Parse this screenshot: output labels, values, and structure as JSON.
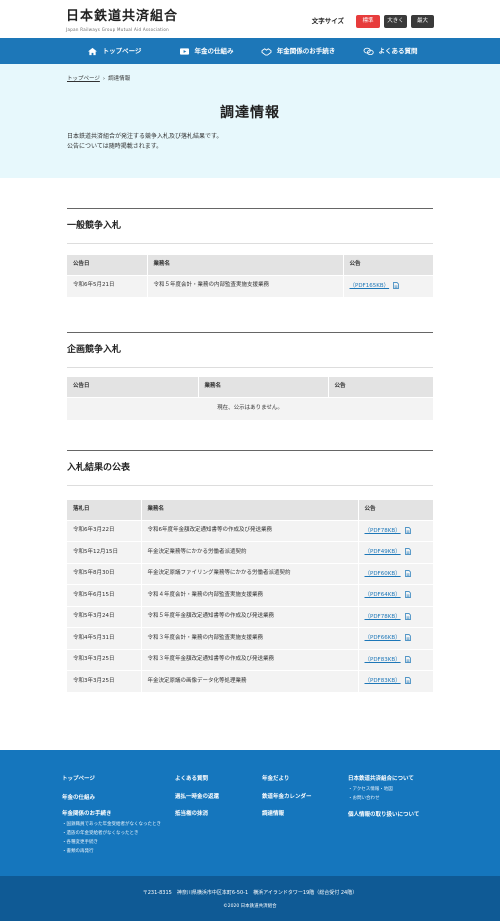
{
  "header": {
    "logo_main": "日本鉄道共済組合",
    "logo_sub": "Japan Railways Group Mutual Aid Association",
    "font_size_label": "文字サイズ",
    "font_sizes": [
      {
        "label": "標準",
        "active": true
      },
      {
        "label": "大きく",
        "active": false
      },
      {
        "label": "最大",
        "active": false
      }
    ]
  },
  "nav": {
    "items": [
      {
        "label": "トップページ",
        "icon": "home-icon"
      },
      {
        "label": "年金の仕組み",
        "icon": "video-icon"
      },
      {
        "label": "年金関係のお手続き",
        "icon": "handshake-icon"
      },
      {
        "label": "よくある質問",
        "icon": "chat-icon"
      }
    ]
  },
  "breadcrumb": {
    "home": "トップページ",
    "separator": "›",
    "current": "調達情報"
  },
  "page_title": "調達情報",
  "intro": {
    "line1": "日本鉄道共済組合が発注する競争入札及び落札結果です。",
    "line2": "公告については随時掲載されます。"
  },
  "sections": {
    "general": {
      "title": "一般競争入札",
      "headers": [
        "公告日",
        "業務名",
        "公告"
      ],
      "rows": [
        {
          "date": "令和6年5月21日",
          "name": "令和５年度会計・業務の内部監査実施支援業務",
          "pdf": "（PDF165KB）"
        }
      ]
    },
    "planning": {
      "title": "企画競争入札",
      "headers": [
        "公告日",
        "業務名",
        "公告"
      ],
      "empty": "現在、公示はありません。"
    },
    "results": {
      "title": "入札結果の公表",
      "headers": [
        "落札日",
        "業務名",
        "公告"
      ],
      "rows": [
        {
          "date": "令和6年3月22日",
          "name": "令和6年度年金額改定通知書等の作成及び発送業務",
          "pdf": "（PDF78KB）"
        },
        {
          "date": "令和5年12月15日",
          "name": "年金決定業務等にかかる労働者派遣契約",
          "pdf": "（PDF49KB）"
        },
        {
          "date": "令和5年8月30日",
          "name": "年金決定原議ファイリング業務等にかかる労働者派遣契約",
          "pdf": "（PDF60KB）"
        },
        {
          "date": "令和5年6月15日",
          "name": "令和４年度会計・業務の内部監査実施支援業務",
          "pdf": "（PDF64KB）"
        },
        {
          "date": "令和5年3月24日",
          "name": "令和５年度年金額改定通知書等の作成及び発送業務",
          "pdf": "（PDF78KB）"
        },
        {
          "date": "令和4年5月31日",
          "name": "令和３年度会計・業務の内部監査実施支援業務",
          "pdf": "（PDF66KB）"
        },
        {
          "date": "令和3年3月25日",
          "name": "令和３年度年金額改定通知書等の作成及び発送業務",
          "pdf": "（PDF83KB）"
        },
        {
          "date": "令和3年3月25日",
          "name": "年金決定原議の画像データ化等処理業務",
          "pdf": "（PDF83KB）"
        }
      ]
    }
  },
  "footer": {
    "col1": {
      "links": [
        "トップページ",
        "年金の仕組み",
        "年金関係のお手続き"
      ],
      "subs": [
        "・国鉄職員であった年金受給者がなくなったとき",
        "・遺族の年金受給者がなくなったとき",
        "・各種変更手続き",
        "・書類の再発行"
      ]
    },
    "col2": {
      "links": [
        "よくある質問",
        "過払一時金の返還",
        "抵当権の抹消"
      ]
    },
    "col3": {
      "links": [
        "年金だより",
        "鉄道年金カレンダー",
        "調達情報"
      ]
    },
    "col4": {
      "links": [
        "日本鉄道共済組合について",
        "個人情報の取り扱いについて"
      ],
      "subs": [
        "・アクセス情報・地図",
        "・お問い合わせ"
      ]
    },
    "address": "〒231-8315　神奈川県横浜市中区本町6-50-1　横浜アイランドタワー19階（総合受付 24階）",
    "copyright": "©2020 日本鉄道共済組合"
  },
  "colors": {
    "brand_blue": "#1d77b8",
    "active_red": "#e73c3c",
    "hero_bg": "#e7f8fc"
  }
}
